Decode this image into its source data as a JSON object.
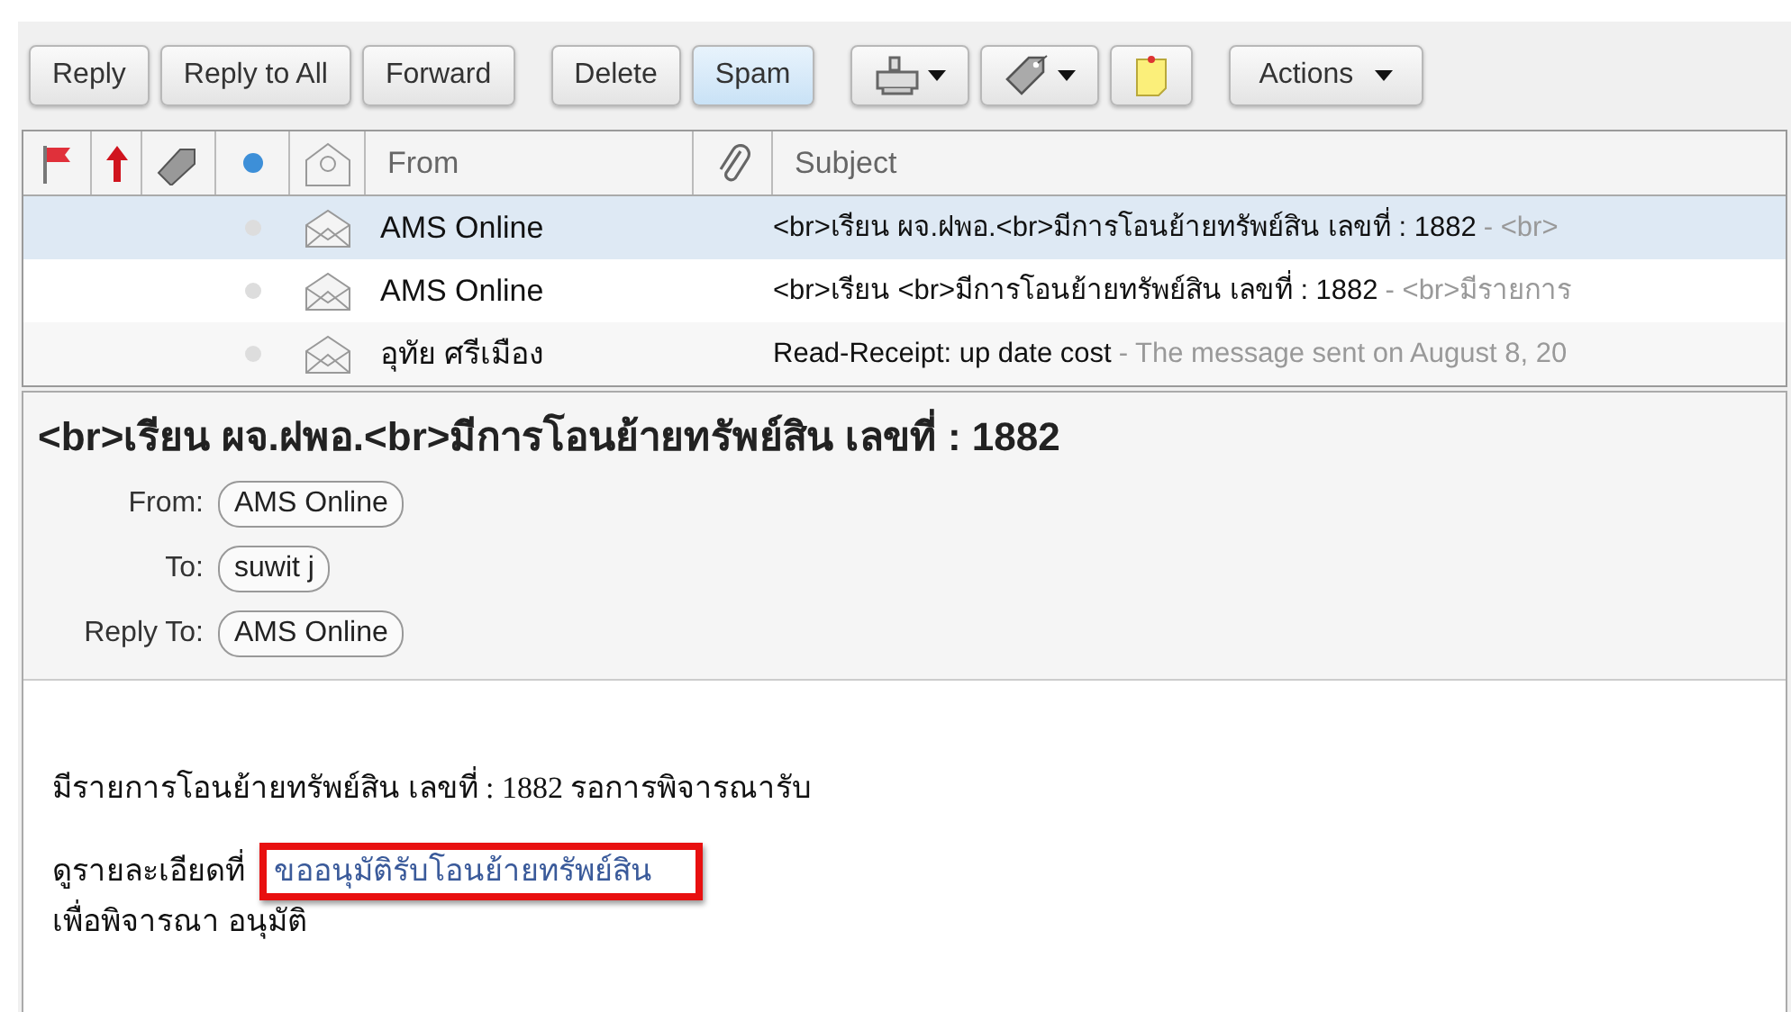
{
  "toolbar": {
    "buttons": [
      {
        "kind": "text",
        "label": "Reply",
        "highlighted": false
      },
      {
        "kind": "text",
        "label": "Reply to All",
        "highlighted": false
      },
      {
        "kind": "text",
        "label": "Forward",
        "highlighted": false
      },
      {
        "kind": "gap"
      },
      {
        "kind": "text",
        "label": "Delete",
        "highlighted": false
      },
      {
        "kind": "text",
        "label": "Spam",
        "highlighted": true
      },
      {
        "kind": "gap"
      },
      {
        "kind": "print-menu"
      },
      {
        "kind": "tag-menu"
      },
      {
        "kind": "note"
      },
      {
        "kind": "gap"
      },
      {
        "kind": "menu",
        "label": "Actions"
      }
    ]
  },
  "message_list": {
    "columns": [
      "From",
      "Subject"
    ],
    "rows": [
      {
        "from": "AMS Online",
        "subject": "<br>เรียน ผจ.ฝพอ.<br>มีการโอนย้ายทรัพย์สิน เลขที่ : 1882",
        "preview": "- <br>",
        "selected": true
      },
      {
        "from": "AMS Online",
        "subject": "<br>เรียน <br>มีการโอนย้ายทรัพย์สิน เลขที่ : 1882",
        "preview": "- <br>มีรายการ",
        "selected": false
      },
      {
        "from": "อุทัย ศรีเมือง",
        "subject": "Read-Receipt: up date cost",
        "preview": "- The message sent on August 8, 20",
        "selected": false
      }
    ]
  },
  "message": {
    "title": "<br>เรียน ผจ.ฝพอ.<br>มีการโอนย้ายทรัพย์สิน เลขที่ : 1882",
    "fields": [
      {
        "label": "From:",
        "value": "AMS Online"
      },
      {
        "label": "To:",
        "value": "suwit j"
      },
      {
        "label": "Reply To:",
        "value": "AMS Online"
      }
    ],
    "body": {
      "line_1": "มีรายการโอนย้ายทรัพย์สิน เลขที่ : 1882 รอการพิจารณารับ",
      "detail_label": "ดูรายละเอียดที่",
      "link": "ขออนุมัติรับโอนย้ายทรัพย์สิน",
      "link_highlighted": true,
      "line_3": "เพื่อพิจารณา อนุมัติ"
    }
  }
}
